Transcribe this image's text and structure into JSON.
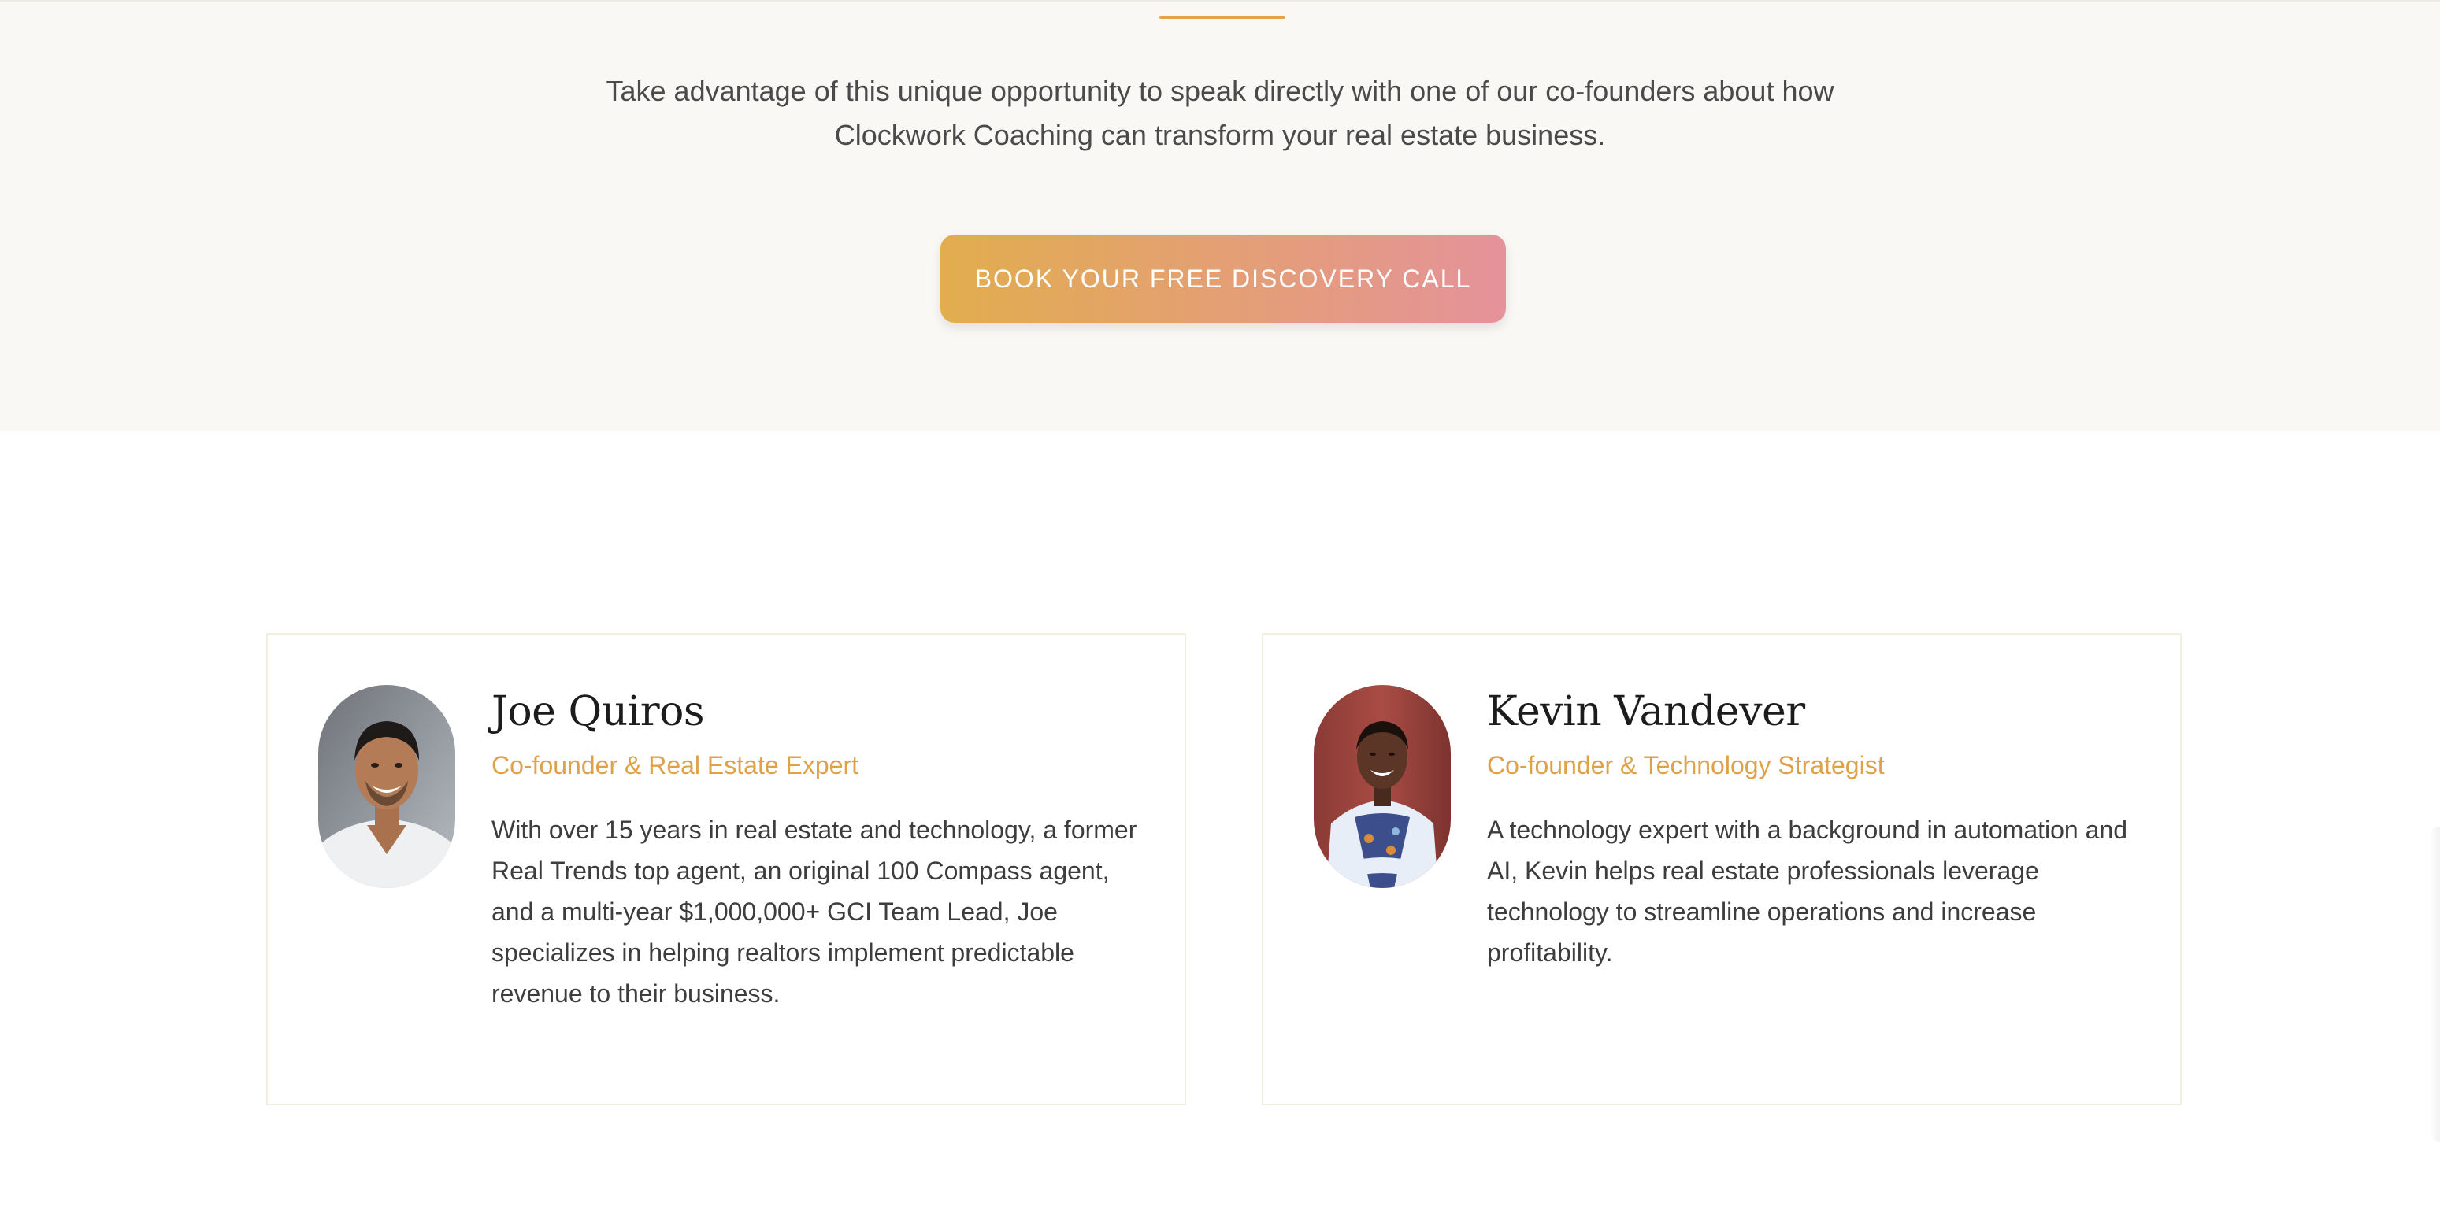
{
  "hero": {
    "intro_line_1": "Take advantage of this unique opportunity to speak directly with one of our co-founders about how",
    "intro_line_2": "Clockwork Coaching can transform your real estate business.",
    "cta_label": "BOOK YOUR FREE DISCOVERY CALL"
  },
  "founders": [
    {
      "name": "Joe Quiros",
      "role": "Co-founder & Real Estate Expert",
      "bio": "With over 15 years in real estate and technology, a former Real Trends top agent, an original 100 Compass agent, and a multi-year $1,000,000+ GCI Team Lead, Joe specializes in helping realtors implement predictable revenue to their business.",
      "avatar_alt": "Joe Quiros"
    },
    {
      "name": "Kevin Vandever",
      "role": "Co-founder & Technology Strategist",
      "bio": "A technology expert with a background in automation and AI, Kevin helps real estate professionals leverage technology to streamline operations and increase profitability.",
      "avatar_alt": "Kevin Vandever"
    }
  ],
  "colors": {
    "accent": "#e0a44a",
    "role_text": "#dea24a",
    "cta_gradient_start": "#e2ad4e",
    "cta_gradient_end": "#e5929a",
    "section_background": "#f9f8f4"
  }
}
